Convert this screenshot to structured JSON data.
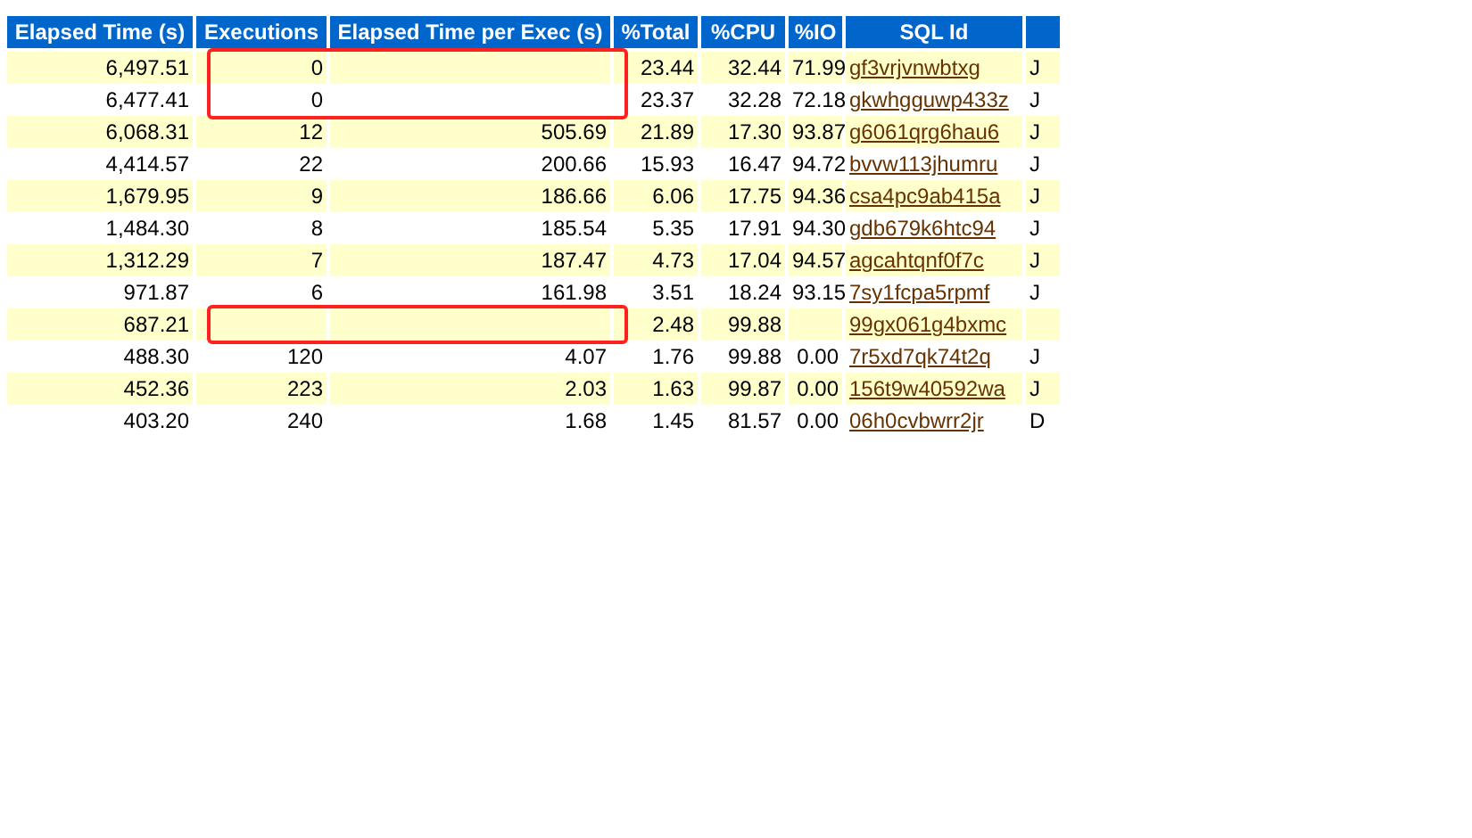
{
  "table": {
    "columns": [
      "Elapsed Time (s)",
      "Executions",
      "Elapsed Time per Exec (s)",
      "%Total",
      "%CPU",
      "%IO",
      "SQL Id"
    ],
    "rows": [
      {
        "cells": [
          "6,497.51",
          "0",
          "",
          "23.44",
          "32.44",
          "71.99",
          "gf3vrjvnwbtxg",
          "J"
        ],
        "annotated": true
      },
      {
        "cells": [
          "6,477.41",
          "0",
          "",
          "23.37",
          "32.28",
          "72.18",
          "gkwhgguwp433z",
          "J"
        ],
        "annotated": true
      },
      {
        "cells": [
          "6,068.31",
          "12",
          "505.69",
          "21.89",
          "17.30",
          "93.87",
          "g6061qrg6hau6",
          "J"
        ],
        "annotated": false
      },
      {
        "cells": [
          "4,414.57",
          "22",
          "200.66",
          "15.93",
          "16.47",
          "94.72",
          "bvvw113jhumru",
          "J"
        ],
        "annotated": false
      },
      {
        "cells": [
          "1,679.95",
          "9",
          "186.66",
          "6.06",
          "17.75",
          "94.36",
          "csa4pc9ab415a",
          "J"
        ],
        "annotated": false
      },
      {
        "cells": [
          "1,484.30",
          "8",
          "185.54",
          "5.35",
          "17.91",
          "94.30",
          "gdb679k6htc94",
          "J"
        ],
        "annotated": false
      },
      {
        "cells": [
          "1,312.29",
          "7",
          "187.47",
          "4.73",
          "17.04",
          "94.57",
          "agcahtqnf0f7c",
          "J"
        ],
        "annotated": false
      },
      {
        "cells": [
          "971.87",
          "6",
          "161.98",
          "3.51",
          "18.24",
          "93.15",
          "7sy1fcpa5rpmf",
          "J"
        ],
        "annotated": false
      },
      {
        "cells": [
          "687.21",
          "",
          "",
          "2.48",
          "99.88",
          "",
          "99gx061g4bxmc",
          ""
        ],
        "annotated": true
      },
      {
        "cells": [
          "488.30",
          "120",
          "4.07",
          "1.76",
          "99.88",
          "0.00",
          "7r5xd7qk74t2q",
          "J"
        ],
        "annotated": false
      },
      {
        "cells": [
          "452.36",
          "223",
          "2.03",
          "1.63",
          "99.87",
          "0.00",
          "156t9w40592wa",
          "J"
        ],
        "annotated": false
      },
      {
        "cells": [
          "403.20",
          "240",
          "1.68",
          "1.45",
          "81.57",
          "0.00",
          "06h0cvbwrr2jr",
          "D"
        ],
        "annotated": false
      }
    ]
  }
}
